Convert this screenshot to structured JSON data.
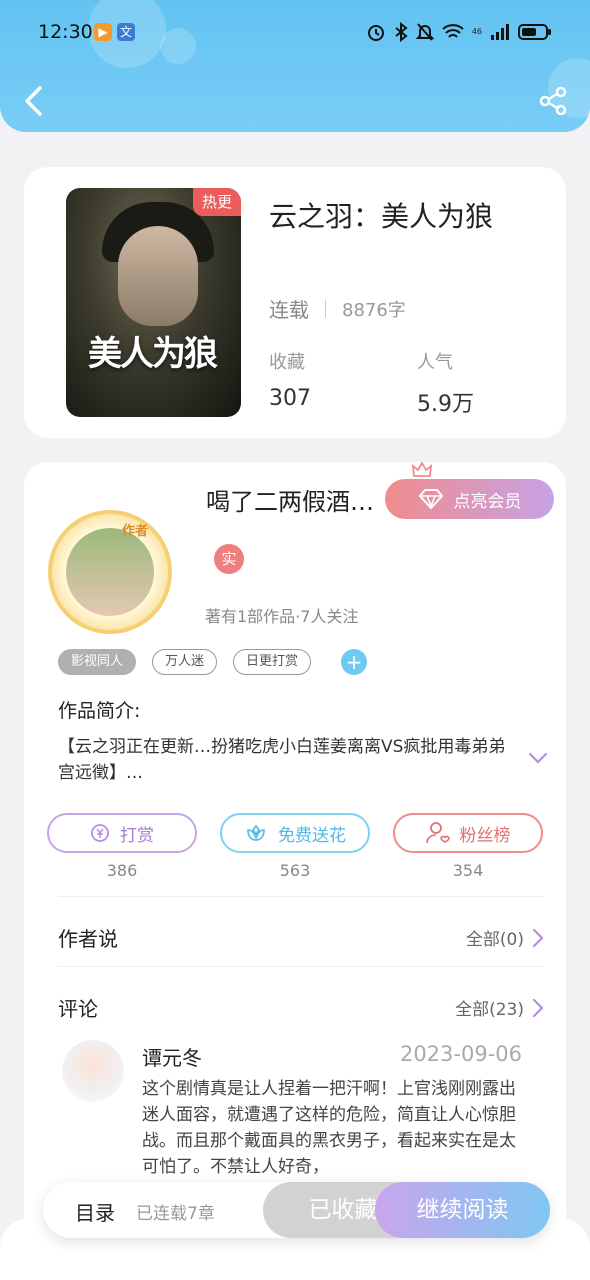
{
  "status_bar": {
    "time": "12:30",
    "network": "46"
  },
  "book": {
    "hot_badge": "热更",
    "cover_title": "美人为狼",
    "title": "云之羽：美人为狼",
    "status": "连载",
    "word_count": "8876字",
    "favorites_label": "收藏",
    "favorites_value": "307",
    "popularity_label": "人气",
    "popularity_value": "5.9万"
  },
  "author": {
    "badge": "作者",
    "name": "喝了二两假酒…",
    "vip_label": "点亮会员",
    "real_badge": "实",
    "meta": "著有1部作品·7人关注"
  },
  "tags": [
    "影视同人",
    "万人迷",
    "日更打赏"
  ],
  "intro": {
    "label": "作品简介:",
    "text": "【云之羽正在更新…扮猪吃虎小白莲姜离离VS疯批用毒弟弟宫远徵】…"
  },
  "actions": {
    "reward_label": "打赏",
    "reward_count": "386",
    "flower_label": "免费送花",
    "flower_count": "563",
    "fans_label": "粉丝榜",
    "fans_count": "354"
  },
  "author_says": {
    "title": "作者说",
    "more": "全部(0)"
  },
  "comments": {
    "title": "评论",
    "more": "全部(23)",
    "items": [
      {
        "user": "谭元冬",
        "date": "2023-09-06",
        "text": "这个剧情真是让人捏着一把汗啊！上官浅刚刚露出迷人面容，就遭遇了这样的危险，简直让人心惊胆战。而且那个戴面具的黑衣男子，看起来实在是太可怕了。不禁让人好奇，"
      }
    ]
  },
  "bottom_bar": {
    "catalog": "目录",
    "chapters": "已连载7章",
    "collected": "已收藏",
    "continue": "继续阅读"
  },
  "colors": {
    "header_blue": "#6ec8f3",
    "vip_gradient_start": "#f08c8c",
    "vip_gradient_end": "#c7a2e6",
    "hot_red": "#ea5d5a"
  }
}
